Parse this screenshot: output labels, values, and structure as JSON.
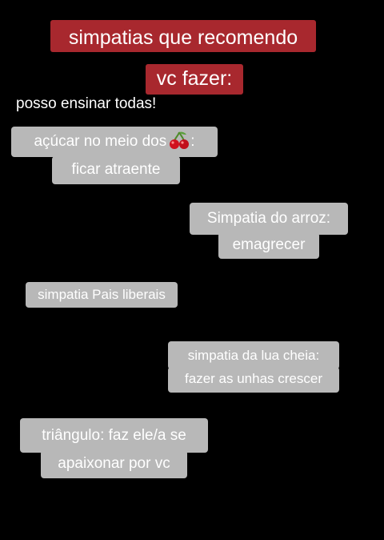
{
  "title": {
    "line1": "simpatias que recomendo",
    "line2": "vc fazer:"
  },
  "caption": "posso ensinar todas!",
  "stickers": [
    {
      "line1_before_icon": "açúcar no meio dos",
      "icon": "cherry-icon",
      "line1_after_icon": ":",
      "line2": "ficar atraente"
    },
    {
      "line1": "Simpatia do arroz:",
      "line2": "emagrecer"
    },
    {
      "line1": "simpatia Pais liberais"
    },
    {
      "line1": "simpatia da lua cheia:",
      "line2": "fazer as unhas crescer"
    },
    {
      "line1": "triângulo: faz ele/a se",
      "line2": "apaixonar por vc"
    }
  ],
  "colors": {
    "background": "#000000",
    "title_bg": "#a8282e",
    "sticker_bg": "#b8b8b8",
    "text": "#ffffff"
  }
}
